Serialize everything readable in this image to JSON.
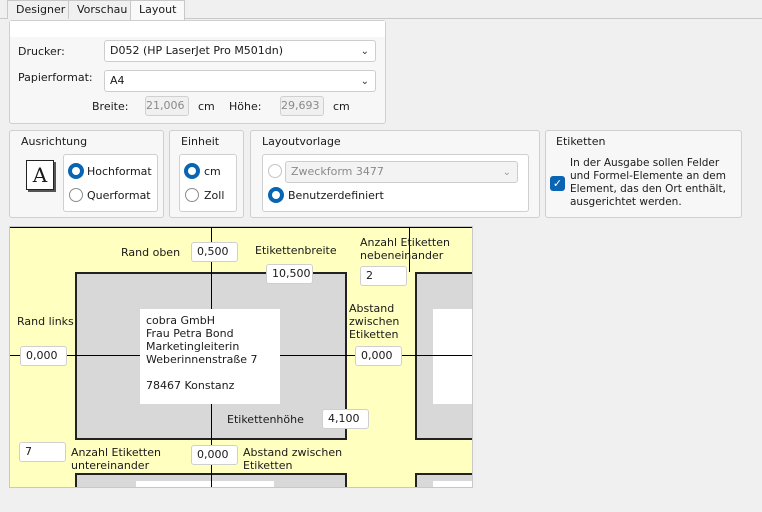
{
  "tabs": [
    "Designer",
    "Vorschau",
    "Layout"
  ],
  "printer": {
    "drucker_label": "Drucker:",
    "drucker_value": "D052 (HP LaserJet Pro M501dn)",
    "papier_label": "Papierformat:",
    "papier_value": "A4",
    "breite_label": "Breite:",
    "breite_value": "21,006",
    "breite_unit": "cm",
    "hoehe_label": "Höhe:",
    "hoehe_value": "29,693",
    "hoehe_unit": "cm"
  },
  "ausrichtung": {
    "title": "Ausrichtung",
    "icon_letter": "A",
    "hoch": "Hochformat",
    "quer": "Querformat",
    "selected": "Hochformat"
  },
  "einheit": {
    "title": "Einheit",
    "cm": "cm",
    "zoll": "Zoll",
    "selected": "cm"
  },
  "layoutvorlage": {
    "title": "Layoutvorlage",
    "template_value": "Zweckform 3477",
    "custom": "Benutzerdefiniert",
    "selected": "Benutzerdefiniert"
  },
  "etiketten": {
    "title": "Etiketten",
    "checked": true,
    "text": "In der Ausgabe sollen Felder und Formel-Elemente an dem Element, das den Ort enthält, ausgerichtet werden."
  },
  "preview": {
    "rand_oben_label": "Rand oben",
    "rand_oben_value": "0,500",
    "breite_label": "Etikettenbreite",
    "breite_value": "10,500",
    "anzahl_neben_label_1": "Anzahl Etiketten",
    "anzahl_neben_label_2": "nebeneinander",
    "anzahl_neben_value": "2",
    "rand_links_label": "Rand links",
    "rand_links_value": "0,000",
    "abstand_h_label_1": "Abstand",
    "abstand_h_label_2": "zwischen",
    "abstand_h_label_3": "Etiketten",
    "abstand_h_value": "0,000",
    "address": [
      "cobra GmbH",
      "Frau Petra Bond",
      "Marketingleiterin",
      "Weberinnenstraße 7",
      "",
      "78467 Konstanz"
    ],
    "hoehe_label": "Etikettenhöhe",
    "hoehe_value": "4,100",
    "anzahl_unter_value": "7",
    "anzahl_unter_label_1": "Anzahl Etiketten",
    "anzahl_unter_label_2": "untereinander",
    "abstand_v_value": "0,000",
    "abstand_v_label_1": "Abstand zwischen",
    "abstand_v_label_2": "Etiketten"
  }
}
